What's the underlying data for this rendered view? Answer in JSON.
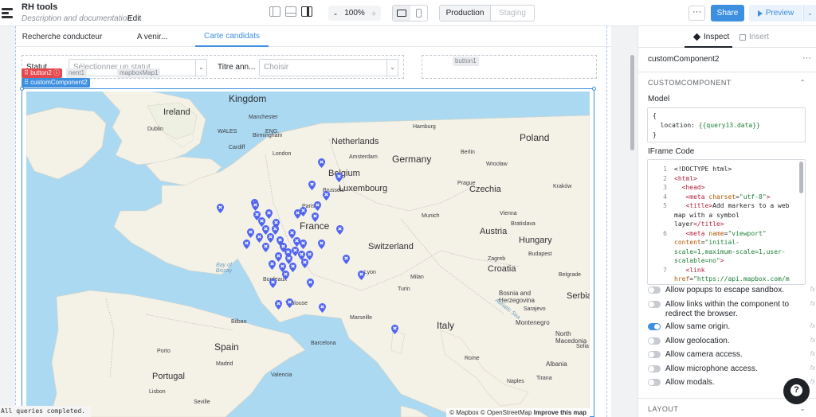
{
  "app": {
    "title": "RH tools",
    "description": "Description and documentation",
    "edit_label": "Edit"
  },
  "toolbar": {
    "zoom_out": "-",
    "zoom_value": "100%",
    "zoom_in": "+",
    "env_production": "Production",
    "env_staging": "Staging",
    "more": "···",
    "share": "Share",
    "preview": "Preview",
    "preview_caret": "⌄"
  },
  "canvas": {
    "tabs": [
      "Recherche conducteur",
      "A venir...",
      "Carte candidats"
    ],
    "active_tab": 2,
    "filters": {
      "statut_label": "Statut",
      "statut_placeholder": "Sélectionner un statut",
      "titre_label": "Titre ann...",
      "titre_placeholder": "Choisir"
    },
    "tags": {
      "button1": "button1",
      "button2": "button2",
      "component1": "nent1",
      "mapbox": "mapboxMap1",
      "custom": "customComponent2"
    },
    "map": {
      "countries": [
        "Kingdom",
        "Ireland",
        "Netherlands",
        "Belgium",
        "Luxembourg",
        "Germany",
        "Czechia",
        "Poland",
        "France",
        "Switzerland",
        "Austria",
        "Hungary",
        "Croatia",
        "Bosnia and Herzegovina",
        "Serbia",
        "Italy",
        "Montenegro",
        "North Macedonia",
        "Spain",
        "Portugal",
        "Albania"
      ],
      "cities": [
        "Cardiff",
        "Dublin",
        "Birmingham",
        "Manchester",
        "ENG.",
        "WALES",
        "London",
        "Amsterdam",
        "Hamburg",
        "Berlin",
        "Prague",
        "Vienna",
        "Munich",
        "Brussels",
        "Paris",
        "Lyon",
        "Milan",
        "Turin",
        "Toulouse",
        "Marseille",
        "Bordeaux",
        "Barcelona",
        "Madrid",
        "Lisbon",
        "Valencia",
        "Rome",
        "Naples",
        "Belgrade",
        "Sarajevo",
        "Zagreb",
        "Bilbao",
        "Porto",
        "Seville",
        "Kraków",
        "Wrocław",
        "Bratislava",
        "Budapest",
        "Sofia",
        "Tirana"
      ],
      "seas": [
        "Bay of Biscay",
        "Adriatic Sea"
      ],
      "attribution": "© Mapbox © OpenStreetMap",
      "attribution_bold": "Improve this map"
    },
    "console": "All queries completed."
  },
  "panel": {
    "tab_inspect": "Inspect",
    "tab_insert": "Insert",
    "component_name": "customComponent2",
    "section_custom": "CUSTOMCOMPONENT",
    "model_label": "Model",
    "model_lines": [
      "{",
      "  location: ",
      "{{query13.data}}",
      "}"
    ],
    "iframe_label": "IFrame Code",
    "code_line_numbers": [
      "1",
      "2",
      "3",
      "4",
      "5",
      "",
      "",
      "6",
      "",
      "",
      "",
      "7"
    ],
    "toggles": [
      {
        "label": "Allow popups to escape sandbox.",
        "on": false
      },
      {
        "label": "Allow links within the component to redirect the browser.",
        "on": false
      },
      {
        "label": "Allow same origin.",
        "on": true
      },
      {
        "label": "Allow geolocation.",
        "on": false
      },
      {
        "label": "Allow camera access.",
        "on": false
      },
      {
        "label": "Allow microphone access.",
        "on": false
      },
      {
        "label": "Allow modals.",
        "on": false
      }
    ],
    "fx_label": "fx",
    "section_layout": "LAYOUT",
    "help": "?"
  },
  "colors": {
    "accent": "#3d8fe0",
    "marker": "#4f63f0",
    "water": "#abd9f2",
    "land": "#f4f1e6"
  }
}
